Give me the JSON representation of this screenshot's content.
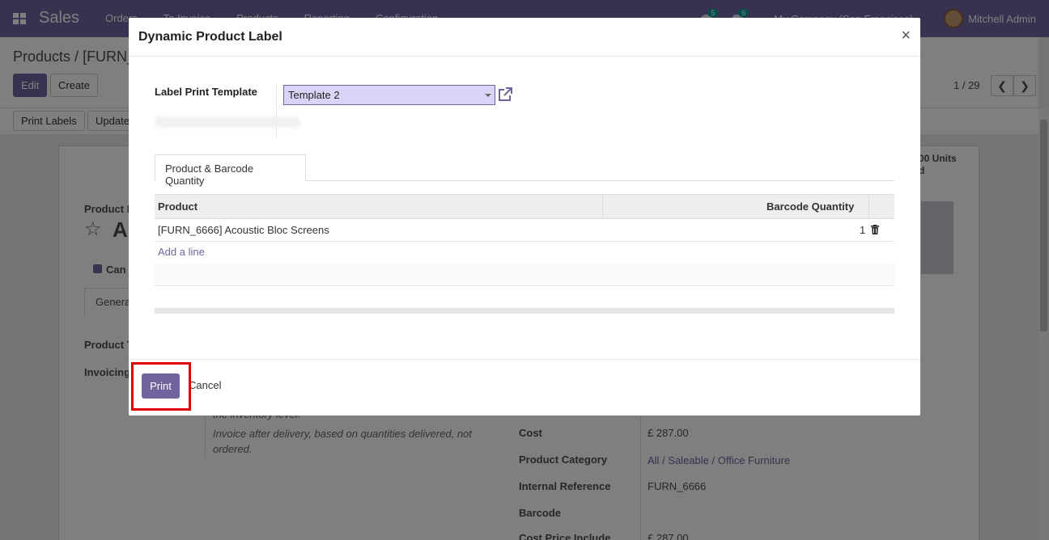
{
  "navbar": {
    "app_name": "Sales",
    "menu": [
      "Orders",
      "To Invoice",
      "Products",
      "Reporting",
      "Configuration"
    ],
    "messages_count": "5",
    "activities_count": "6",
    "company": "My Company (San Francisco)",
    "user": "Mitchell Admin"
  },
  "background": {
    "breadcrumb_parent": "Products",
    "breadcrumb_current": "[FURN_",
    "edit_label": "Edit",
    "create_label": "Create",
    "pager": "1 / 29",
    "print_labels": "Print Labels",
    "update_label": "Update",
    "units_badge_line1": "00 Units",
    "units_badge_line2": "d",
    "product_label": "Product N",
    "product_name_fragment": "A",
    "can_label": "Can",
    "general_tab": "Genera",
    "product_type_label": "Product T",
    "invoicing_label": "Invoicing",
    "note_top": "the inventory level.",
    "note_main": "Invoice after delivery, based on quantities delivered, not ordered.",
    "fields": [
      {
        "label": "Cost",
        "value": "£ 287.00",
        "link": false
      },
      {
        "label": "Product Category",
        "value": "All / Saleable / Office Furniture",
        "link": true
      },
      {
        "label": "Internal Reference",
        "value": "FURN_6666",
        "link": false
      },
      {
        "label": "Barcode",
        "value": "",
        "link": false
      },
      {
        "label": "Cost Price Include",
        "value": "£ 287.00",
        "link": false
      }
    ]
  },
  "modal": {
    "title": "Dynamic Product Label",
    "close": "×",
    "template_label": "Label Print Template",
    "template_value": "Template 2",
    "tab_label": "Product & Barcode Quantity",
    "columns": {
      "product": "Product",
      "qty": "Barcode Quantity"
    },
    "rows": [
      {
        "product": "[FURN_6666] Acoustic Bloc Screens",
        "qty": "1"
      }
    ],
    "add_line": "Add a line",
    "print_label": "Print",
    "cancel_label": "Cancel"
  },
  "colors": {
    "brand": "#71639e",
    "highlight": "#e00000"
  }
}
